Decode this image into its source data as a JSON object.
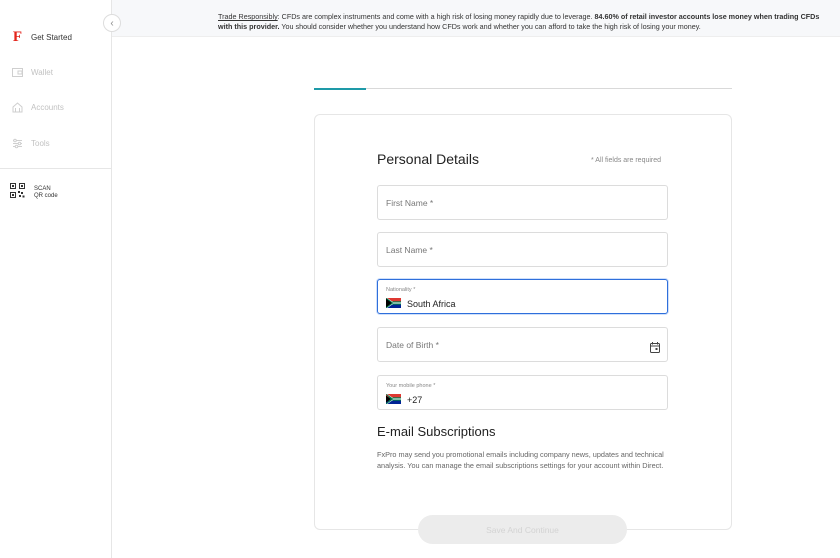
{
  "sidebar": {
    "collapse_icon": "chevron-left-icon",
    "items": [
      {
        "label": "Get Started",
        "icon": "fxpro-f-logo",
        "active": true
      },
      {
        "label": "Wallet",
        "icon": "wallet-icon",
        "active": false
      },
      {
        "label": "Accounts",
        "icon": "accounts-icon",
        "active": false
      },
      {
        "label": "Tools",
        "icon": "tools-icon",
        "active": false
      }
    ],
    "scan": {
      "line1": "SCAN",
      "line2": "QR code",
      "icon": "qr-code-icon"
    }
  },
  "banner": {
    "link": "Trade Responsibly",
    "text1": ": CFDs are complex instruments and come with a high risk of losing money rapidly due to leverage. ",
    "bold": "84.60% of retail investor accounts lose money when trading CFDs with this provider.",
    "text2": " You should consider whether you understand how CFDs work and whether you can afford to take the high risk of losing your money."
  },
  "form": {
    "title": "Personal Details",
    "required_note": "* All fields are required",
    "first_name_placeholder": "First Name *",
    "last_name_placeholder": "Last Name *",
    "nationality_label": "Nationality *",
    "nationality_value": "South Africa",
    "dob_placeholder": "Date of Birth *",
    "phone_label": "Your mobile phone *",
    "phone_code": "+27"
  },
  "subscriptions": {
    "title": "E-mail Subscriptions",
    "description": "FxPro may send you promotional emails including company news, updates and technical analysis. You can manage the email subscriptions settings for your account within Direct."
  },
  "save_button": "Save And Continue",
  "colors": {
    "brand": "#e3241b",
    "accent": "#1e9aa8",
    "focus": "#2f6fdb"
  }
}
